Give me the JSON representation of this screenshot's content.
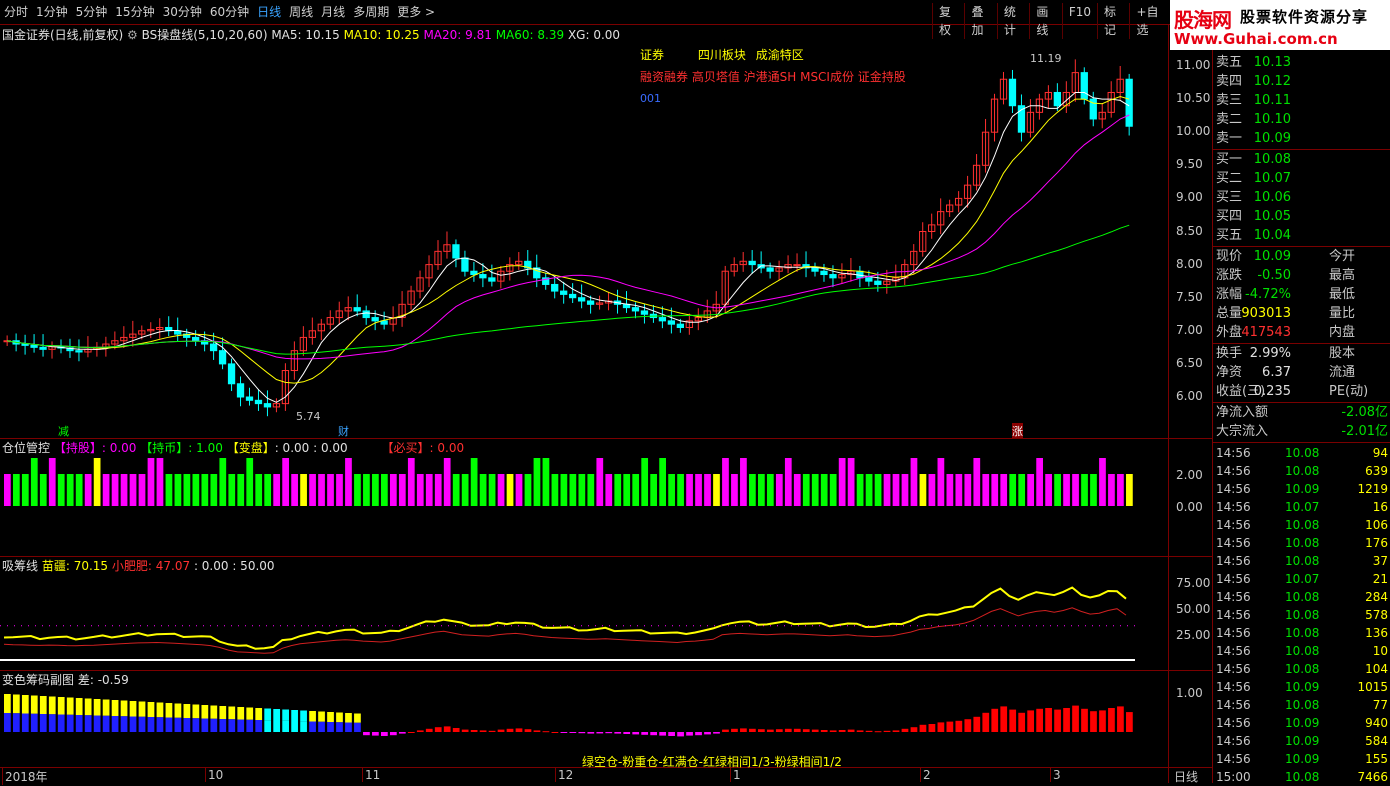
{
  "toolbar": {
    "timeframes": [
      "分时",
      "1分钟",
      "5分钟",
      "15分钟",
      "30分钟",
      "60分钟",
      "日线",
      "周线",
      "月线",
      "多周期",
      "更多 >"
    ],
    "active_index": 6,
    "right_tools": [
      "复权",
      "叠加",
      "统计",
      "画线",
      "F10",
      "标记",
      "+自选"
    ]
  },
  "logo": {
    "brand": "股海网",
    "slogan": "股票软件资源分享",
    "url": "Www.Guhai.com.cn"
  },
  "main_title": {
    "stock": "国金证券(日线,前复权)",
    "indicator": "BS操盘线(5,10,20,60)",
    "ma5": "MA5: 10.15",
    "ma10": "MA10: 10.25",
    "ma20": "MA20: 9.81",
    "ma60": "MA60: 8.39",
    "xg": "XG: 0.00"
  },
  "info": {
    "sector1": "证券",
    "sector2": "四川板块",
    "sector3": "成渝特区",
    "concepts": "融资融券 高贝塔值 沪港通SH MSCI成份 证金持股",
    "code": "001"
  },
  "price_labels": {
    "high": "11.19",
    "low": "5.74"
  },
  "event_tags": [
    "减",
    "财",
    "涨"
  ],
  "price_axis": [
    "11.00",
    "10.50",
    "10.00",
    "9.50",
    "9.00",
    "8.50",
    "8.00",
    "7.50",
    "7.00",
    "6.50",
    "6.00"
  ],
  "panel2": {
    "title": "仓位管控",
    "chigu_label": "【持股】",
    "chigu_value": ": 0.00",
    "chibi_label": "【持币】",
    "chibi_value": ": 1.00",
    "biangpan_label": "【变盘】",
    "biangpan_value": ": 0.00 : 0.00",
    "bimai_label": "【必买】",
    "bimai_value": ": 0.00",
    "axis": [
      "2.00",
      "0.00"
    ]
  },
  "panel3": {
    "title": "吸筹线",
    "miaojiang": "苗疆: 70.15",
    "xiaofeifei": "小肥肥: 47.07",
    "rest": ": 0.00   : 50.00",
    "axis": [
      "75.00",
      "50.00",
      "25.00"
    ]
  },
  "panel4": {
    "title": "变色筹码副图",
    "diff": "差: -0.59",
    "axis": [
      "1.00"
    ],
    "legend": "绿空仓-粉重仓-红满仓-红绿相间1/3-粉绿相间1/2"
  },
  "date_axis": [
    "2018年",
    "10",
    "11",
    "12",
    "1",
    "2",
    "3"
  ],
  "date_axis_right": "日线",
  "quote": {
    "asks": [
      {
        "label": "卖五",
        "price": "10.13"
      },
      {
        "label": "卖四",
        "price": "10.12"
      },
      {
        "label": "卖三",
        "price": "10.11"
      },
      {
        "label": "卖二",
        "price": "10.10"
      },
      {
        "label": "卖一",
        "price": "10.09"
      }
    ],
    "bids": [
      {
        "label": "买一",
        "price": "10.08"
      },
      {
        "label": "买二",
        "price": "10.07"
      },
      {
        "label": "买三",
        "price": "10.06"
      },
      {
        "label": "买四",
        "price": "10.05"
      },
      {
        "label": "买五",
        "price": "10.04"
      }
    ],
    "stats": [
      {
        "l": "现价",
        "v": "10.09",
        "r": "今开",
        "c": "#00e000"
      },
      {
        "l": "涨跌",
        "v": "-0.50",
        "r": "最高",
        "c": "#00e000"
      },
      {
        "l": "涨幅",
        "v": "-4.72%",
        "r": "最低",
        "c": "#00e000"
      },
      {
        "l": "总量",
        "v": "903013",
        "r": "量比",
        "c": "#ffff00"
      },
      {
        "l": "外盘",
        "v": "417543",
        "r": "内盘",
        "c": "#ff3030"
      }
    ],
    "stats2": [
      {
        "l": "换手",
        "v": "2.99%",
        "r": "股本"
      },
      {
        "l": "净资",
        "v": "6.37",
        "r": "流通"
      },
      {
        "l": "收益(三)",
        "v": "0.235",
        "r": "PE(动)"
      }
    ],
    "flows": [
      {
        "l": "净流入额",
        "v": "-2.08亿"
      },
      {
        "l": "大宗流入",
        "v": "-2.01亿"
      }
    ],
    "ticks": [
      {
        "t": "14:56",
        "p": "10.08",
        "v": "94"
      },
      {
        "t": "14:56",
        "p": "10.08",
        "v": "639"
      },
      {
        "t": "14:56",
        "p": "10.09",
        "v": "1219"
      },
      {
        "t": "14:56",
        "p": "10.07",
        "v": "16"
      },
      {
        "t": "14:56",
        "p": "10.08",
        "v": "106"
      },
      {
        "t": "14:56",
        "p": "10.08",
        "v": "176"
      },
      {
        "t": "14:56",
        "p": "10.08",
        "v": "37"
      },
      {
        "t": "14:56",
        "p": "10.07",
        "v": "21"
      },
      {
        "t": "14:56",
        "p": "10.08",
        "v": "284"
      },
      {
        "t": "14:56",
        "p": "10.08",
        "v": "578"
      },
      {
        "t": "14:56",
        "p": "10.08",
        "v": "136"
      },
      {
        "t": "14:56",
        "p": "10.08",
        "v": "10"
      },
      {
        "t": "14:56",
        "p": "10.08",
        "v": "104"
      },
      {
        "t": "14:56",
        "p": "10.09",
        "v": "1015"
      },
      {
        "t": "14:56",
        "p": "10.08",
        "v": "77"
      },
      {
        "t": "14:56",
        "p": "10.09",
        "v": "940"
      },
      {
        "t": "14:56",
        "p": "10.09",
        "v": "584"
      },
      {
        "t": "14:56",
        "p": "10.09",
        "v": "155"
      },
      {
        "t": "15:00",
        "p": "10.08",
        "v": "7466"
      }
    ]
  },
  "colors": {
    "up": "#ff3030",
    "down": "#00ffff",
    "ma5": "#ffffff",
    "ma10": "#ffff00",
    "ma20": "#ff00ff",
    "ma60": "#00ff00",
    "border": "#7a0000"
  },
  "chart_data": {
    "type": "candlestick",
    "price_range": [
      5.74,
      11.19
    ],
    "closes": [
      6.85,
      6.8,
      6.78,
      6.75,
      6.72,
      6.76,
      6.74,
      6.7,
      6.68,
      6.72,
      6.75,
      6.8,
      6.85,
      6.9,
      6.95,
      7.0,
      7.02,
      7.05,
      7.0,
      6.95,
      6.9,
      6.85,
      6.8,
      6.7,
      6.5,
      6.2,
      6.0,
      5.95,
      5.9,
      5.85,
      5.9,
      6.4,
      6.7,
      6.9,
      7.0,
      7.1,
      7.2,
      7.3,
      7.35,
      7.3,
      7.2,
      7.15,
      7.1,
      7.2,
      7.4,
      7.6,
      7.8,
      8.0,
      8.2,
      8.3,
      8.1,
      7.9,
      7.85,
      7.8,
      7.75,
      7.9,
      8.0,
      8.05,
      7.95,
      7.8,
      7.7,
      7.6,
      7.55,
      7.5,
      7.45,
      7.4,
      7.42,
      7.45,
      7.4,
      7.35,
      7.3,
      7.25,
      7.2,
      7.15,
      7.1,
      7.05,
      7.15,
      7.2,
      7.3,
      7.4,
      7.9,
      8.0,
      8.05,
      8.0,
      7.95,
      7.9,
      7.95,
      8.0,
      8.0,
      7.95,
      7.9,
      7.85,
      7.8,
      7.85,
      7.9,
      7.8,
      7.75,
      7.7,
      7.75,
      7.8,
      8.0,
      8.2,
      8.5,
      8.6,
      8.8,
      8.9,
      9.0,
      9.2,
      9.5,
      10.0,
      10.5,
      10.8,
      10.4,
      10.0,
      10.3,
      10.5,
      10.6,
      10.4,
      10.6,
      10.9,
      10.5,
      10.2,
      10.3,
      10.6,
      10.8,
      10.09
    ]
  }
}
